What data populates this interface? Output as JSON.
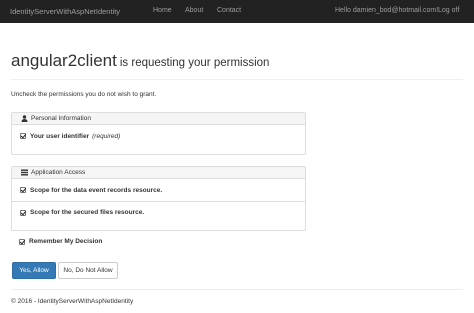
{
  "navbar": {
    "brand": "IdentityServerWithAspNetIdentity",
    "links": [
      "Home",
      "About",
      "Contact"
    ],
    "user": "Hello damien_bod@hotmail.com!",
    "logoff": "Log off",
    "background": "#222222"
  },
  "consent": {
    "client_name": "angular2client",
    "request_text": "is requesting your permission",
    "instructions": "Uncheck the permissions you do not wish to grant."
  },
  "personal": {
    "heading": "Personal Information",
    "icon": "user-icon",
    "items": [
      {
        "label": "Your user identifier",
        "note": "(required)",
        "checked": true
      }
    ]
  },
  "access": {
    "heading": "Application Access",
    "icon": "list-icon",
    "items": [
      {
        "label": "Scope for the data event records resource.",
        "checked": true
      },
      {
        "label": "Scope for the secured files resource.",
        "checked": true
      }
    ]
  },
  "remember": {
    "label": "Remember My Decision",
    "checked": true
  },
  "buttons": {
    "yes": "Yes, Allow",
    "no": "No, Do Not Allow",
    "primary_color": "#337ab7"
  },
  "footer": {
    "text": "© 2016 - IdentityServerWithAspNetIdentity"
  }
}
